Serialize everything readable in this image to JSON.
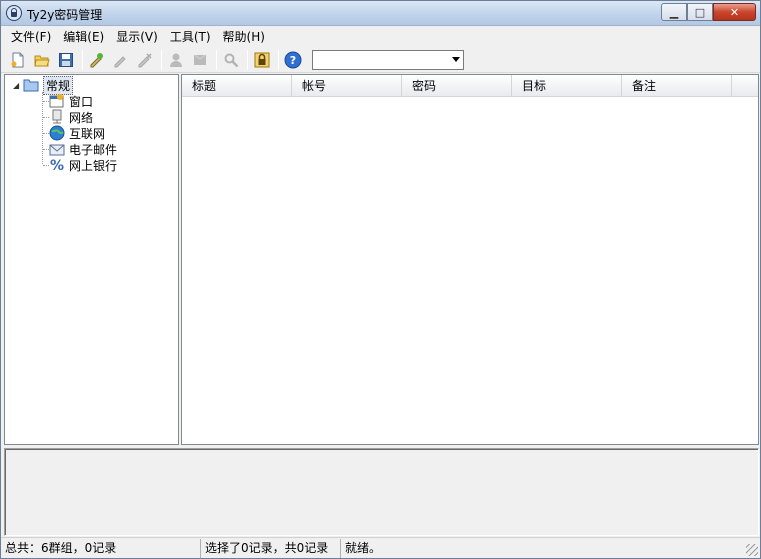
{
  "window": {
    "title": "Ty2y密码管理"
  },
  "caption": {
    "minimize": "▁",
    "maximize": "□",
    "close": "✕"
  },
  "menu": [
    "文件(F)",
    "编辑(E)",
    "显示(V)",
    "工具(T)",
    "帮助(H)"
  ],
  "toolbar": {
    "buttons": [
      {
        "name": "new-icon",
        "glyph": "🗋"
      },
      {
        "name": "open-folder-icon",
        "glyph": "📂"
      },
      {
        "name": "save-icon",
        "glyph": "💾"
      },
      {
        "name": "add-record-icon",
        "glyph": "✎"
      },
      {
        "name": "edit-record-icon",
        "glyph": "✎"
      },
      {
        "name": "delete-record-icon",
        "glyph": "✎"
      },
      {
        "name": "user-icon",
        "glyph": "👤"
      },
      {
        "name": "group-icon",
        "glyph": "▮"
      },
      {
        "name": "search-icon",
        "glyph": "🔍"
      },
      {
        "name": "lock-icon",
        "glyph": "🔒"
      },
      {
        "name": "help-icon",
        "glyph": "?"
      }
    ],
    "search_value": ""
  },
  "tree": {
    "root": {
      "label": "常规",
      "icon": "folder-icon"
    },
    "children": [
      {
        "label": "窗口",
        "icon": "window-icon"
      },
      {
        "label": "网络",
        "icon": "network-icon"
      },
      {
        "label": "互联网",
        "icon": "internet-icon"
      },
      {
        "label": "电子邮件",
        "icon": "email-icon"
      },
      {
        "label": "网上银行",
        "icon": "bank-icon"
      }
    ]
  },
  "list": {
    "columns": [
      "标题",
      "帐号",
      "密码",
      "目标",
      "备注"
    ]
  },
  "status": {
    "total": "总共：6群组，0记录",
    "selected": "选择了0记录，共0记录",
    "state": "就绪。"
  },
  "colors": {
    "accent": "#2b5797",
    "title_gradient": "#c3d5ec"
  }
}
